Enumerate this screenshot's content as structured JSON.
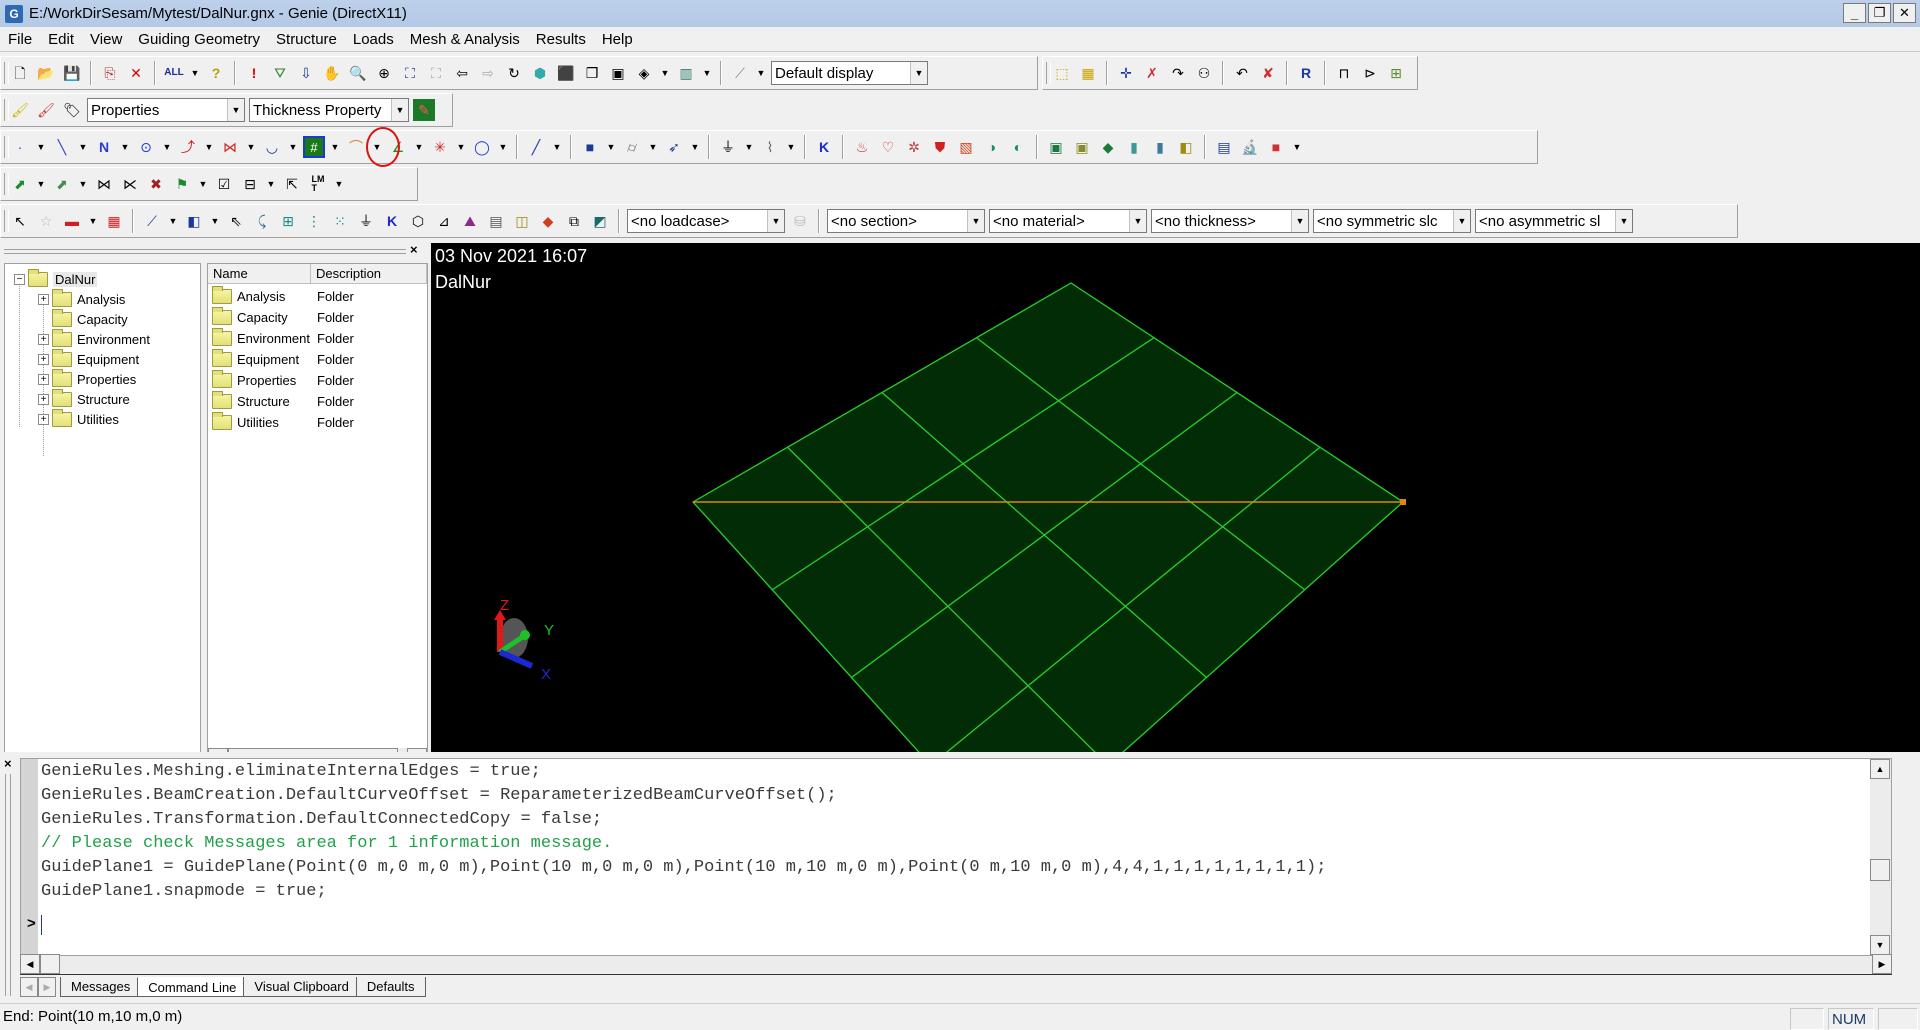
{
  "window": {
    "title": "E:/WorkDirSesam/Mytest/DalNur.gnx - Genie (DirectX11)",
    "app_icon": "G",
    "controls": {
      "minimize": "_",
      "restore": "❐",
      "close": "✕"
    }
  },
  "menu": [
    "File",
    "Edit",
    "View",
    "Guiding Geometry",
    "Structure",
    "Loads",
    "Mesh & Analysis",
    "Results",
    "Help"
  ],
  "toolbars": {
    "row1": {
      "icons": [
        "new-file",
        "open-folder",
        "save",
        "copy",
        "delete",
        "select-all",
        "help",
        "alert",
        "rotate-view",
        "pan-down",
        "pan-hand",
        "zoom-box",
        "rotate-center",
        "zoom-all",
        "zoom-selected",
        "previous-view",
        "next-view",
        "refresh",
        "shaded-cube",
        "cube-add",
        "cube-copy",
        "cube-front",
        "section-view",
        "clip-view",
        "display-config"
      ],
      "display_combo": "Default display",
      "right_icons": [
        "select-point",
        "select-multiple",
        "pick-point",
        "remove-pick",
        "trace-path",
        "show-labels",
        "undo-transform",
        "delete-selection",
        "report",
        "measure",
        "property-panel",
        "grid-view"
      ]
    },
    "row2": {
      "icons": [
        "paint-brush-yellow",
        "paint-brush-red",
        "property-tag"
      ],
      "properties_combo": "Properties",
      "thickness_combo": "Thickness Property",
      "apply_icon": "apply-property"
    },
    "row3": {
      "icons": [
        "point",
        "line",
        "polyline",
        "circle",
        "curve",
        "intersection",
        "surface-curve",
        "guide-plane",
        "polycurve",
        "axis-system",
        "cross-lines",
        "ellipse",
        "straight-beam",
        "plate",
        "pipe",
        "stiffener",
        "support",
        "spring",
        "hinge",
        "load-1",
        "load-2",
        "load-3",
        "load-4",
        "load-5",
        "load-6",
        "load-7",
        "panel-1",
        "panel-2",
        "panel-3",
        "panel-4",
        "panel-5",
        "panel-6",
        "panel-7",
        "microscope",
        "color"
      ],
      "highlighted": "guide-plane",
      "highlight_color": "#e01010"
    },
    "row4": {
      "icons": [
        "mesh-feature-1",
        "mesh-feature-2",
        "split-1",
        "split-2",
        "remove-mesh",
        "mesh-flag",
        "checkbox-mesh",
        "mesh-grid",
        "mesh-cursor",
        "LMT"
      ]
    },
    "row5": {
      "icons": [
        "select-arrow",
        "select-star",
        "select-rect",
        "grid-select",
        "select-line",
        "select-plate",
        "select-point",
        "select-curve",
        "select-grid",
        "select-node",
        "select-multi",
        "select-support",
        "select-hinge",
        "select-solid",
        "select-beam",
        "select-load",
        "select-panel",
        "select-shape",
        "select-color",
        "select-pipe",
        "select-box"
      ],
      "loadcase_combo": "<no loadcase>",
      "section_combo": "<no section>",
      "material_combo": "<no material>",
      "thickness_combo": "<no thickness>",
      "symmetric_combo": "<no symmetric slc",
      "asymmetric_combo": "<no asymmetric sl"
    }
  },
  "browser": {
    "tree": {
      "root": "DalNur",
      "children": [
        {
          "label": "Analysis",
          "expandable": true
        },
        {
          "label": "Capacity",
          "expandable": false
        },
        {
          "label": "Environment",
          "expandable": true
        },
        {
          "label": "Equipment",
          "expandable": true
        },
        {
          "label": "Properties",
          "expandable": true
        },
        {
          "label": "Structure",
          "expandable": true
        },
        {
          "label": "Utilities",
          "expandable": true
        }
      ]
    },
    "list": {
      "columns": [
        "Name",
        "Description"
      ],
      "rows": [
        {
          "name": "Analysis",
          "description": "Folder"
        },
        {
          "name": "Capacity",
          "description": "Folder"
        },
        {
          "name": "Environment",
          "description": "Folder"
        },
        {
          "name": "Equipment",
          "description": "Folder"
        },
        {
          "name": "Properties",
          "description": "Folder"
        },
        {
          "name": "Structure",
          "description": "Folder"
        },
        {
          "name": "Utilities",
          "description": "Folder"
        }
      ]
    }
  },
  "viewport": {
    "timestamp": "03 Nov 2021 16:07",
    "model_name": "DalNur",
    "guide_plane": {
      "divisions_u": 4,
      "divisions_v": 4,
      "fill_color": "#022c06",
      "line_color": "#26d02a",
      "highlight_line_color": "#e0860e"
    },
    "axes": {
      "x": "X",
      "y": "Y",
      "z": "Z"
    }
  },
  "command_line": {
    "lines": [
      {
        "text": "GenieRules.Meshing.eliminateInternalEdges = true;",
        "type": "code"
      },
      {
        "text": "GenieRules.BeamCreation.DefaultCurveOffset = ReparameterizedBeamCurveOffset();",
        "type": "code"
      },
      {
        "text": "GenieRules.Transformation.DefaultConnectedCopy = false;",
        "type": "code"
      },
      {
        "text": "// Please check Messages area for 1 information message.",
        "type": "comment"
      },
      {
        "text": "GuidePlane1 = GuidePlane(Point(0 m,0 m,0 m),Point(10 m,0 m,0 m),Point(10 m,10 m,0 m),Point(0 m,10 m,0 m),4,4,1,1,1,1,1,1,1,1);",
        "type": "code"
      },
      {
        "text": "GuidePlane1.snapmode = true;",
        "type": "code"
      }
    ],
    "prompt": ">",
    "input_value": ""
  },
  "tabs": [
    {
      "label": "Messages",
      "active": false
    },
    {
      "label": "Command Line",
      "active": true
    },
    {
      "label": "Visual Clipboard",
      "active": false
    },
    {
      "label": "Defaults",
      "active": false
    }
  ],
  "status": {
    "message": "End: Point(10 m,10 m,0 m)",
    "num": "NUM"
  }
}
